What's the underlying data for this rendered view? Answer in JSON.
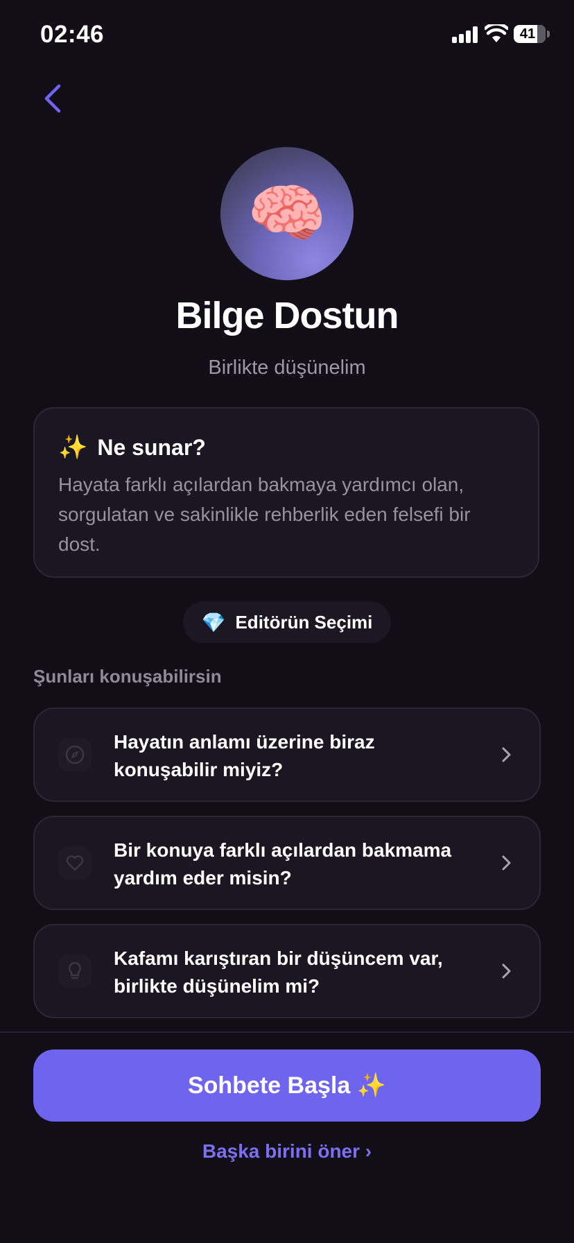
{
  "status_bar": {
    "time": "02:46",
    "battery": "41"
  },
  "profile": {
    "avatar_emoji": "🧠",
    "name": "Bilge Dostun",
    "tagline": "Birlikte düşünelim"
  },
  "info_card": {
    "icon": "✨",
    "title": "Ne sunar?",
    "description": "Hayata farklı açılardan bakmaya yardımcı olan, sorgulatan ve sakinlikle rehberlik eden felsefi bir dost."
  },
  "badge": {
    "icon": "💎",
    "label": "Editörün Seçimi"
  },
  "topics": {
    "section_title": "Şunları konuşabilirsin",
    "items": [
      {
        "icon": "compass-icon",
        "text": "Hayatın anlamı üzerine biraz konuşabilir miyiz?"
      },
      {
        "icon": "heart-icon",
        "text": "Bir konuya farklı açılardan bakmama yardım eder misin?"
      },
      {
        "icon": "lightbulb-icon",
        "text": "Kafamı karıştıran bir düşüncem var, birlikte düşünelim mi?"
      }
    ]
  },
  "actions": {
    "start_chat": "Sohbete Başla ✨",
    "suggest_other": "Başka birini öner ›"
  },
  "colors": {
    "background": "#110e18",
    "accent": "#6e64ee",
    "card": "#1a1722",
    "link": "#7c6ff0"
  }
}
